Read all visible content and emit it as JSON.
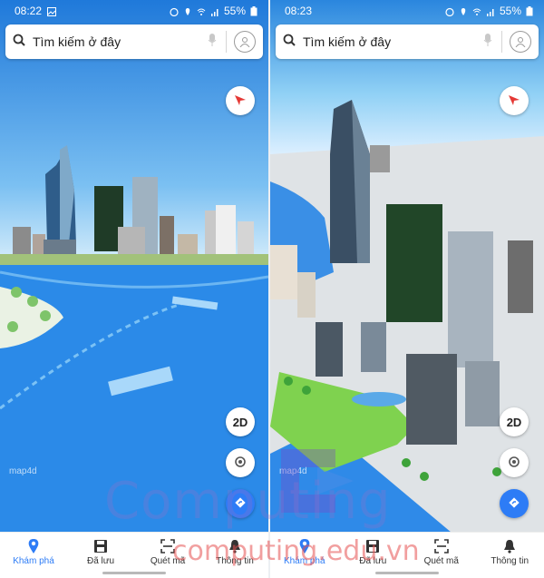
{
  "screens": [
    {
      "status": {
        "time": "08:22",
        "battery": "55%"
      },
      "search": {
        "placeholder": "Tìm kiếm ở đây"
      },
      "map_logo": "map4d",
      "view_mode": "2D",
      "nav": [
        "Khám phá",
        "Đã lưu",
        "Quét mã",
        "Thông tin"
      ]
    },
    {
      "status": {
        "time": "08:23",
        "battery": "55%"
      },
      "search": {
        "placeholder": "Tìm kiếm ở đây"
      },
      "map_logo": "map4d",
      "view_mode": "2D",
      "nav": [
        "Khám phá",
        "Đã lưu",
        "Quét mã",
        "Thông tin"
      ]
    }
  ],
  "watermark": {
    "big": "Computing",
    "small": "computing.edu.vn"
  },
  "colors": {
    "accent": "#2d7cf6",
    "compass": "#e53935"
  }
}
